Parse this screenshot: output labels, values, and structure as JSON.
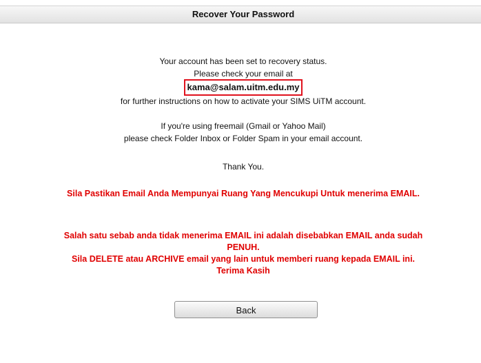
{
  "header": {
    "title": "Recover Your Password"
  },
  "message": {
    "line1": "Your account has been set to recovery status.",
    "line2": "Please check your email at",
    "email": "kama@salam.uitm.edu.my",
    "line3": "for further instructions on how to activate your SIMS UiTM account.",
    "line4": "If you're using freemail (Gmail or Yahoo Mail)",
    "line5": "please check Folder Inbox or Folder Spam in your email account.",
    "thanks": "Thank You."
  },
  "notice": {
    "line1": "Sila Pastikan Email Anda Mempunyai Ruang Yang Mencukupi Untuk menerima EMAIL.",
    "line2": "Salah satu sebab anda tidak menerima EMAIL ini adalah disebabkan EMAIL anda sudah",
    "line3": "PENUH.",
    "line4": "Sila DELETE atau ARCHIVE email yang lain untuk memberi ruang kepada EMAIL ini.",
    "line5": "Terima Kasih"
  },
  "actions": {
    "back_label": "Back"
  },
  "colors": {
    "notice": "#e00000",
    "email_highlight_border": "#e0111c"
  }
}
